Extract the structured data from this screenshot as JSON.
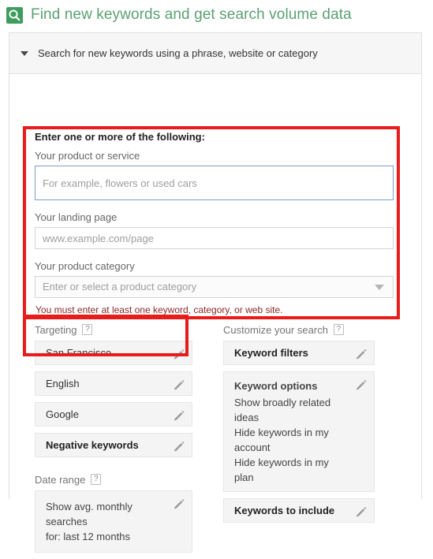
{
  "header": {
    "icon": "search-icon",
    "title": "Find new keywords and get search volume data",
    "title_color": "#5ba173",
    "icon_bg": "#3f9c5f"
  },
  "collapse_bar": {
    "caret": "caret-down-icon",
    "label": "Search for new keywords using a phrase, website or category"
  },
  "inputs": {
    "heading": "Enter one or more of the following:",
    "product": {
      "label": "Your product or service",
      "placeholder": "For example, flowers or used cars",
      "value": "",
      "focused": true
    },
    "landing_page": {
      "label": "Your landing page",
      "placeholder": "www.example.com/page",
      "value": ""
    },
    "category": {
      "label": "Your product category",
      "placeholder": "Enter or select a product category",
      "value": "",
      "caret": "dropdown-caret-icon"
    },
    "warning": "You must enter at least one keyword, category, or web site."
  },
  "targeting": {
    "title": "Targeting",
    "help": "?",
    "items": [
      {
        "label": "San Francisco",
        "bold": false,
        "edit_icon": "pencil-icon"
      },
      {
        "label": "English",
        "bold": false,
        "edit_icon": "pencil-icon"
      },
      {
        "label": "Google",
        "bold": false,
        "edit_icon": "pencil-icon"
      },
      {
        "label": "Negative keywords",
        "bold": true,
        "edit_icon": "pencil-icon"
      }
    ]
  },
  "date_range": {
    "title": "Date range",
    "help": "?",
    "line1": "Show avg. monthly searches",
    "line2": "for: last 12 months",
    "edit_icon": "pencil-icon"
  },
  "customize": {
    "title": "Customize your search",
    "help": "?",
    "keyword_filters": {
      "title": "Keyword filters",
      "edit_icon": "pencil-icon"
    },
    "keyword_options": {
      "title": "Keyword options",
      "edit_icon": "pencil-icon",
      "lines": [
        "Show broadly related ideas",
        "Hide keywords in my account",
        "Hide keywords in my plan"
      ]
    },
    "keywords_to_include": {
      "title": "Keywords to include",
      "edit_icon": "pencil-icon"
    }
  },
  "annotations": {
    "color": "#ea1b1b",
    "boxes": [
      "inputs-highlight",
      "targeting-highlight"
    ]
  }
}
